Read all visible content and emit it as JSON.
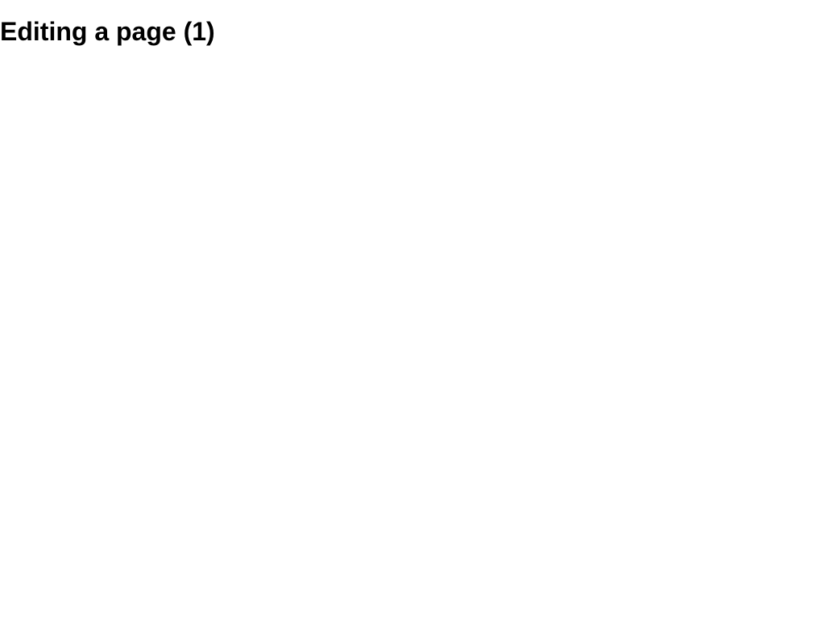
{
  "title": "Editing a page (1)"
}
